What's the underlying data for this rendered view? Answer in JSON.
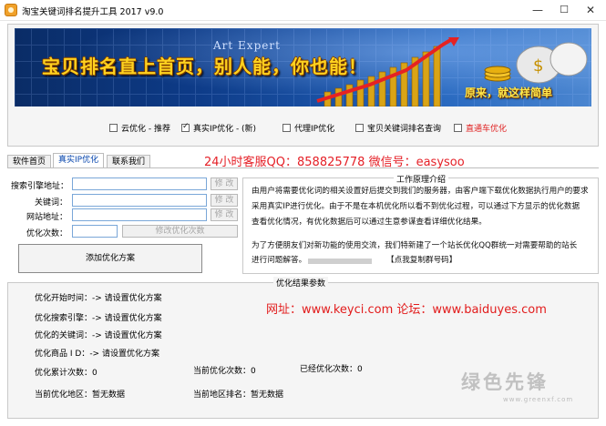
{
  "window": {
    "title": "淘宝关键词排名提升工具 2017 v9.0",
    "min_symbol": "—",
    "max_symbol": "☐",
    "close_symbol": "✕",
    "icon": "taobao-app-icon"
  },
  "banner": {
    "watermark_text": "Art Expert",
    "slogan": "宝贝排名直上首页，别人能，你也能！",
    "sub_slogan": "原来，就这样简单"
  },
  "options": [
    {
      "label": "云优化 - 推荐",
      "checked": false
    },
    {
      "label": "真实IP优化 - (新)",
      "checked": true
    },
    {
      "label": "代理IP优化",
      "checked": false
    },
    {
      "label": "宝贝关键词排名查询",
      "checked": false
    },
    {
      "label": "直通车优化",
      "checked": false,
      "color": "#e02020"
    }
  ],
  "tabs": [
    {
      "label": "软件首页",
      "active": false
    },
    {
      "label": "真实IP优化",
      "active": true
    },
    {
      "label": "联系我们",
      "active": false
    }
  ],
  "contact": {
    "qq_line": "24小时客服QQ：858825778 微信号：easysoo"
  },
  "form": {
    "search_engine_label": "搜索引擎地址：",
    "keyword_label": "关键词：",
    "site_label": "网站地址：",
    "count_label": "优化次数：",
    "search_engine_value": "",
    "keyword_value": "",
    "site_value": "",
    "count_value": "",
    "modify_label": "修 改",
    "modify_count_label": "修改优化次数",
    "add_plan_label": "添加优化方案"
  },
  "principle": {
    "title": "工作原理介绍",
    "lines": [
      "由用户将需要优化词的相关设置好后提交到我们的服务器，由客户端下载优化数据执行用户的要求",
      "采用真实IP进行优化。由于不是在本机优化所以看不到优化过程，可以通过下方显示的优化数据",
      "查看优化情况，有优化数据后可以通过生意参谋查看详细优化结果。",
      "为了方便朋友们对新功能的使用交流，我们特新建了一个站长优化QQ群统一对需要帮助的站长",
      "进行问题解答。"
    ],
    "group_link": "【点我复制群号码】"
  },
  "results": {
    "title": "优化结果参数",
    "start_time_label": "优化开始时间：",
    "start_time_value": "-> 请设置优化方案",
    "engine_label": "优化搜索引擎：",
    "engine_value": "-> 请设置优化方案",
    "keyword_label": "优化的关键词：",
    "keyword_value": "-> 请设置优化方案",
    "product_label": "优化商品 I D：",
    "product_value": "-> 请设置优化方案",
    "total_label": "优化累计次数：",
    "total_value": "0",
    "current_count_label": "当前优化次数：",
    "current_count_value": "0",
    "done_label": "已经优化次数：",
    "done_value": "0",
    "region_label": "当前优化地区：",
    "region_value": "暂无数据",
    "region_rank_label": "当前地区排名：",
    "region_rank_value": "暂无数据",
    "website_line": "网址：www.keyci.com 论坛：www.baiduyes.com"
  },
  "watermark": {
    "text": "绿色先锋",
    "url": "www.greenxf.com"
  }
}
